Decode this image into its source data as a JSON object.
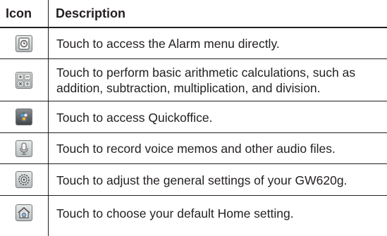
{
  "header": {
    "icon": "Icon",
    "description": "Description"
  },
  "rows": [
    {
      "icon": "alarm-clock-icon",
      "description": "Touch to access the Alarm menu directly."
    },
    {
      "icon": "calculator-icon",
      "description": [
        "Touch to perform basic arithmetic calculations, such as",
        "addition, subtraction, multiplication, and division."
      ]
    },
    {
      "icon": "quickoffice-icon",
      "description": "Touch to access Quickoffice."
    },
    {
      "icon": "microphone-icon",
      "description": "Touch to record voice memos and other audio files."
    },
    {
      "icon": "settings-gear-icon",
      "description": "Touch to adjust the general settings of your GW620g."
    },
    {
      "icon": "home-icon",
      "description": "Touch to choose your default Home setting."
    }
  ],
  "colors": {
    "text": "#231f20",
    "rule": "#231f20",
    "icon_bg": "#c8cdce"
  }
}
